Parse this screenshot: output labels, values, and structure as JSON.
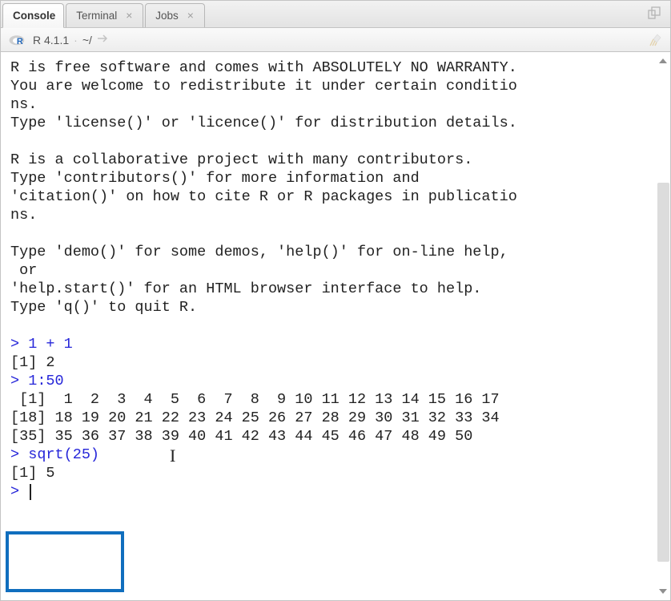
{
  "tabs": {
    "console": "Console",
    "terminal": "Terminal",
    "jobs": "Jobs"
  },
  "subbar": {
    "version": "R 4.1.1",
    "sep": "·",
    "wd": "~/"
  },
  "console": {
    "l1": "R is free software and comes with ABSOLUTELY NO WARRANTY.",
    "l2": "You are welcome to redistribute it under certain conditio",
    "l3": "ns.",
    "l4": "Type 'license()' or 'licence()' for distribution details.",
    "l5": "",
    "l6": "R is a collaborative project with many contributors.",
    "l7": "Type 'contributors()' for more information and",
    "l8": "'citation()' on how to cite R or R packages in publicatio",
    "l9": "ns.",
    "l10": "",
    "l11": "Type 'demo()' for some demos, 'help()' for on-line help,",
    "l12": " or",
    "l13": "'help.start()' for an HTML browser interface to help.",
    "l14": "Type 'q()' to quit R.",
    "l15": "",
    "prompt": "> ",
    "cmd1": "1 + 1",
    "out1": "[1] 2",
    "cmd2": "1:50",
    "out2a": " [1]  1  2  3  4  5  6  7  8  9 10 11 12 13 14 15 16 17",
    "out2b": "[18] 18 19 20 21 22 23 24 25 26 27 28 29 30 31 32 33 34",
    "out2c": "[35] 35 36 37 38 39 40 41 42 43 44 45 46 47 48 49 50",
    "cmd3": "sqrt(25)",
    "out3": "[1] 5"
  }
}
